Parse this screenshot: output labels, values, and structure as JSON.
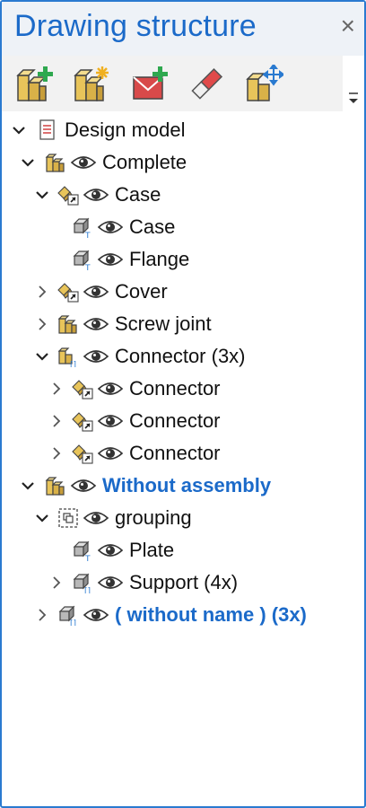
{
  "panel": {
    "title": "Drawing structure",
    "close_glyph": "×"
  },
  "toolbar": {
    "buttons": [
      {
        "name": "new-assembly-icon"
      },
      {
        "name": "new-assembly-star-icon"
      },
      {
        "name": "add-envelope-icon"
      },
      {
        "name": "eraser-icon"
      },
      {
        "name": "move-assembly-icon"
      }
    ],
    "more_glyph": "▾"
  },
  "tree": {
    "root": {
      "label": "Design model"
    },
    "complete": {
      "label": "Complete"
    },
    "case_group": {
      "label": "Case"
    },
    "case_part": {
      "label": "Case"
    },
    "flange": {
      "label": "Flange"
    },
    "cover": {
      "label": "Cover"
    },
    "screw_joint": {
      "label": "Screw joint"
    },
    "connector_group": {
      "label": "Connector (3x)"
    },
    "connector_1": {
      "label": "Connector"
    },
    "connector_2": {
      "label": "Connector"
    },
    "connector_3": {
      "label": "Connector"
    },
    "without_assembly": {
      "label": "Without assembly"
    },
    "grouping": {
      "label": "grouping"
    },
    "plate": {
      "label": "Plate"
    },
    "support": {
      "label": "Support (4x)"
    },
    "without_name": {
      "label": "( without name ) (3x)"
    }
  },
  "colors": {
    "accent": "#1b6ac9",
    "border": "#2a7ad0",
    "part_yellow": "#e8c45a",
    "part_gray": "#b8b8b8"
  }
}
